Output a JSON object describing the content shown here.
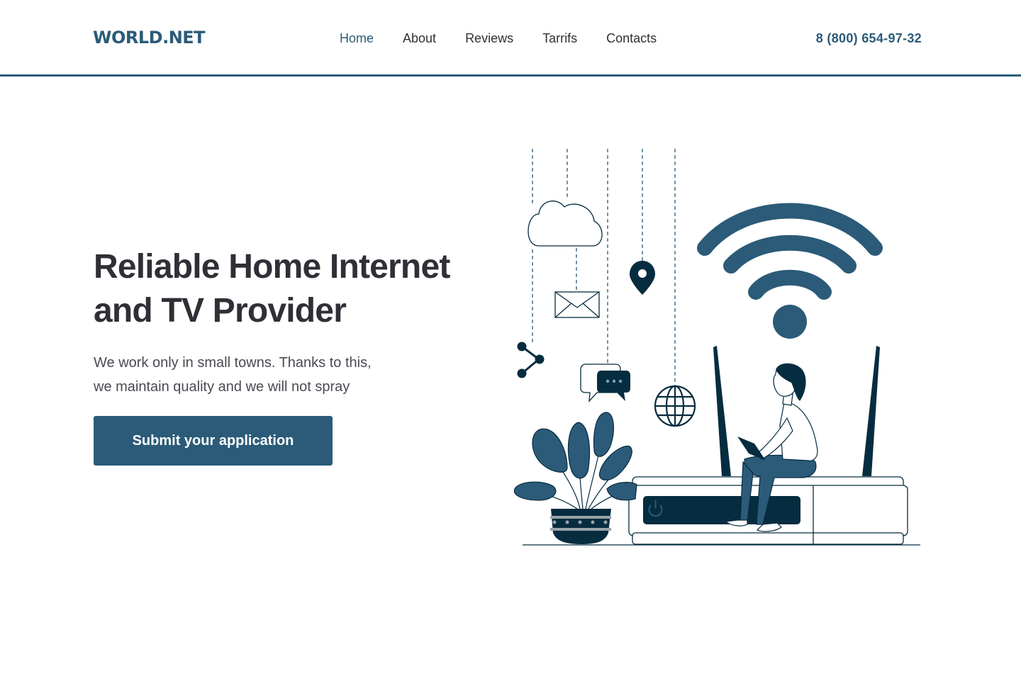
{
  "header": {
    "logo": "WORLD.NET",
    "nav": [
      {
        "label": "Home",
        "active": true
      },
      {
        "label": "About",
        "active": false
      },
      {
        "label": "Reviews",
        "active": false
      },
      {
        "label": "Tarrifs",
        "active": false
      },
      {
        "label": "Contacts",
        "active": false
      }
    ],
    "phone": "8 (800) 654-97-32"
  },
  "hero": {
    "title_line1": "Reliable Home Internet",
    "title_line2": "and TV Provider",
    "text_line1": "We work only in small towns. Thanks to this,",
    "text_line2": "we maintain quality and we will not spray",
    "cta_label": "Submit your application"
  },
  "colors": {
    "accent": "#2b5b78",
    "dark": "#062c40",
    "text": "#2f3036"
  },
  "illustration": {
    "icons": [
      "cloud-icon",
      "mail-icon",
      "location-pin-icon",
      "share-icon",
      "chat-icon",
      "globe-icon",
      "wifi-icon",
      "router-icon",
      "plant-icon",
      "person-with-laptop"
    ]
  }
}
